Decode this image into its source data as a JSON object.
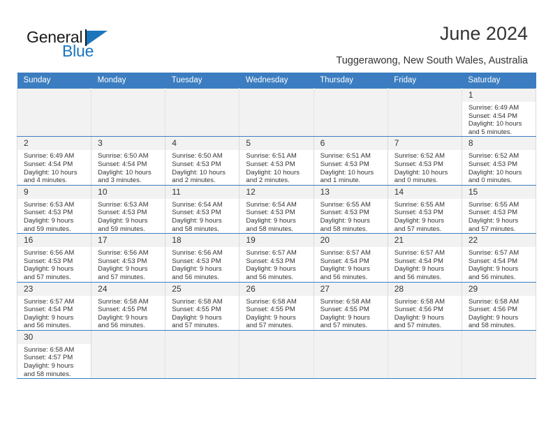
{
  "brand": {
    "name_part1": "General",
    "name_part2": "Blue",
    "accent_color": "#1b75bb"
  },
  "header": {
    "title": "June 2024",
    "subtitle": "Tuggerawong, New South Wales, Australia",
    "header_bg_color": "#3b7dc0"
  },
  "weekdays": [
    "Sunday",
    "Monday",
    "Tuesday",
    "Wednesday",
    "Thursday",
    "Friday",
    "Saturday"
  ],
  "days": {
    "1": {
      "num": "1",
      "sunrise": "Sunrise: 6:49 AM",
      "sunset": "Sunset: 4:54 PM",
      "daylight1": "Daylight: 10 hours",
      "daylight2": "and 5 minutes."
    },
    "2": {
      "num": "2",
      "sunrise": "Sunrise: 6:49 AM",
      "sunset": "Sunset: 4:54 PM",
      "daylight1": "Daylight: 10 hours",
      "daylight2": "and 4 minutes."
    },
    "3": {
      "num": "3",
      "sunrise": "Sunrise: 6:50 AM",
      "sunset": "Sunset: 4:54 PM",
      "daylight1": "Daylight: 10 hours",
      "daylight2": "and 3 minutes."
    },
    "4": {
      "num": "4",
      "sunrise": "Sunrise: 6:50 AM",
      "sunset": "Sunset: 4:53 PM",
      "daylight1": "Daylight: 10 hours",
      "daylight2": "and 2 minutes."
    },
    "5": {
      "num": "5",
      "sunrise": "Sunrise: 6:51 AM",
      "sunset": "Sunset: 4:53 PM",
      "daylight1": "Daylight: 10 hours",
      "daylight2": "and 2 minutes."
    },
    "6": {
      "num": "6",
      "sunrise": "Sunrise: 6:51 AM",
      "sunset": "Sunset: 4:53 PM",
      "daylight1": "Daylight: 10 hours",
      "daylight2": "and 1 minute."
    },
    "7": {
      "num": "7",
      "sunrise": "Sunrise: 6:52 AM",
      "sunset": "Sunset: 4:53 PM",
      "daylight1": "Daylight: 10 hours",
      "daylight2": "and 0 minutes."
    },
    "8": {
      "num": "8",
      "sunrise": "Sunrise: 6:52 AM",
      "sunset": "Sunset: 4:53 PM",
      "daylight1": "Daylight: 10 hours",
      "daylight2": "and 0 minutes."
    },
    "9": {
      "num": "9",
      "sunrise": "Sunrise: 6:53 AM",
      "sunset": "Sunset: 4:53 PM",
      "daylight1": "Daylight: 9 hours",
      "daylight2": "and 59 minutes."
    },
    "10": {
      "num": "10",
      "sunrise": "Sunrise: 6:53 AM",
      "sunset": "Sunset: 4:53 PM",
      "daylight1": "Daylight: 9 hours",
      "daylight2": "and 59 minutes."
    },
    "11": {
      "num": "11",
      "sunrise": "Sunrise: 6:54 AM",
      "sunset": "Sunset: 4:53 PM",
      "daylight1": "Daylight: 9 hours",
      "daylight2": "and 58 minutes."
    },
    "12": {
      "num": "12",
      "sunrise": "Sunrise: 6:54 AM",
      "sunset": "Sunset: 4:53 PM",
      "daylight1": "Daylight: 9 hours",
      "daylight2": "and 58 minutes."
    },
    "13": {
      "num": "13",
      "sunrise": "Sunrise: 6:55 AM",
      "sunset": "Sunset: 4:53 PM",
      "daylight1": "Daylight: 9 hours",
      "daylight2": "and 58 minutes."
    },
    "14": {
      "num": "14",
      "sunrise": "Sunrise: 6:55 AM",
      "sunset": "Sunset: 4:53 PM",
      "daylight1": "Daylight: 9 hours",
      "daylight2": "and 57 minutes."
    },
    "15": {
      "num": "15",
      "sunrise": "Sunrise: 6:55 AM",
      "sunset": "Sunset: 4:53 PM",
      "daylight1": "Daylight: 9 hours",
      "daylight2": "and 57 minutes."
    },
    "16": {
      "num": "16",
      "sunrise": "Sunrise: 6:56 AM",
      "sunset": "Sunset: 4:53 PM",
      "daylight1": "Daylight: 9 hours",
      "daylight2": "and 57 minutes."
    },
    "17": {
      "num": "17",
      "sunrise": "Sunrise: 6:56 AM",
      "sunset": "Sunset: 4:53 PM",
      "daylight1": "Daylight: 9 hours",
      "daylight2": "and 57 minutes."
    },
    "18": {
      "num": "18",
      "sunrise": "Sunrise: 6:56 AM",
      "sunset": "Sunset: 4:53 PM",
      "daylight1": "Daylight: 9 hours",
      "daylight2": "and 56 minutes."
    },
    "19": {
      "num": "19",
      "sunrise": "Sunrise: 6:57 AM",
      "sunset": "Sunset: 4:53 PM",
      "daylight1": "Daylight: 9 hours",
      "daylight2": "and 56 minutes."
    },
    "20": {
      "num": "20",
      "sunrise": "Sunrise: 6:57 AM",
      "sunset": "Sunset: 4:54 PM",
      "daylight1": "Daylight: 9 hours",
      "daylight2": "and 56 minutes."
    },
    "21": {
      "num": "21",
      "sunrise": "Sunrise: 6:57 AM",
      "sunset": "Sunset: 4:54 PM",
      "daylight1": "Daylight: 9 hours",
      "daylight2": "and 56 minutes."
    },
    "22": {
      "num": "22",
      "sunrise": "Sunrise: 6:57 AM",
      "sunset": "Sunset: 4:54 PM",
      "daylight1": "Daylight: 9 hours",
      "daylight2": "and 56 minutes."
    },
    "23": {
      "num": "23",
      "sunrise": "Sunrise: 6:57 AM",
      "sunset": "Sunset: 4:54 PM",
      "daylight1": "Daylight: 9 hours",
      "daylight2": "and 56 minutes."
    },
    "24": {
      "num": "24",
      "sunrise": "Sunrise: 6:58 AM",
      "sunset": "Sunset: 4:55 PM",
      "daylight1": "Daylight: 9 hours",
      "daylight2": "and 56 minutes."
    },
    "25": {
      "num": "25",
      "sunrise": "Sunrise: 6:58 AM",
      "sunset": "Sunset: 4:55 PM",
      "daylight1": "Daylight: 9 hours",
      "daylight2": "and 57 minutes."
    },
    "26": {
      "num": "26",
      "sunrise": "Sunrise: 6:58 AM",
      "sunset": "Sunset: 4:55 PM",
      "daylight1": "Daylight: 9 hours",
      "daylight2": "and 57 minutes."
    },
    "27": {
      "num": "27",
      "sunrise": "Sunrise: 6:58 AM",
      "sunset": "Sunset: 4:55 PM",
      "daylight1": "Daylight: 9 hours",
      "daylight2": "and 57 minutes."
    },
    "28": {
      "num": "28",
      "sunrise": "Sunrise: 6:58 AM",
      "sunset": "Sunset: 4:56 PM",
      "daylight1": "Daylight: 9 hours",
      "daylight2": "and 57 minutes."
    },
    "29": {
      "num": "29",
      "sunrise": "Sunrise: 6:58 AM",
      "sunset": "Sunset: 4:56 PM",
      "daylight1": "Daylight: 9 hours",
      "daylight2": "and 58 minutes."
    },
    "30": {
      "num": "30",
      "sunrise": "Sunrise: 6:58 AM",
      "sunset": "Sunset: 4:57 PM",
      "daylight1": "Daylight: 9 hours",
      "daylight2": "and 58 minutes."
    }
  }
}
